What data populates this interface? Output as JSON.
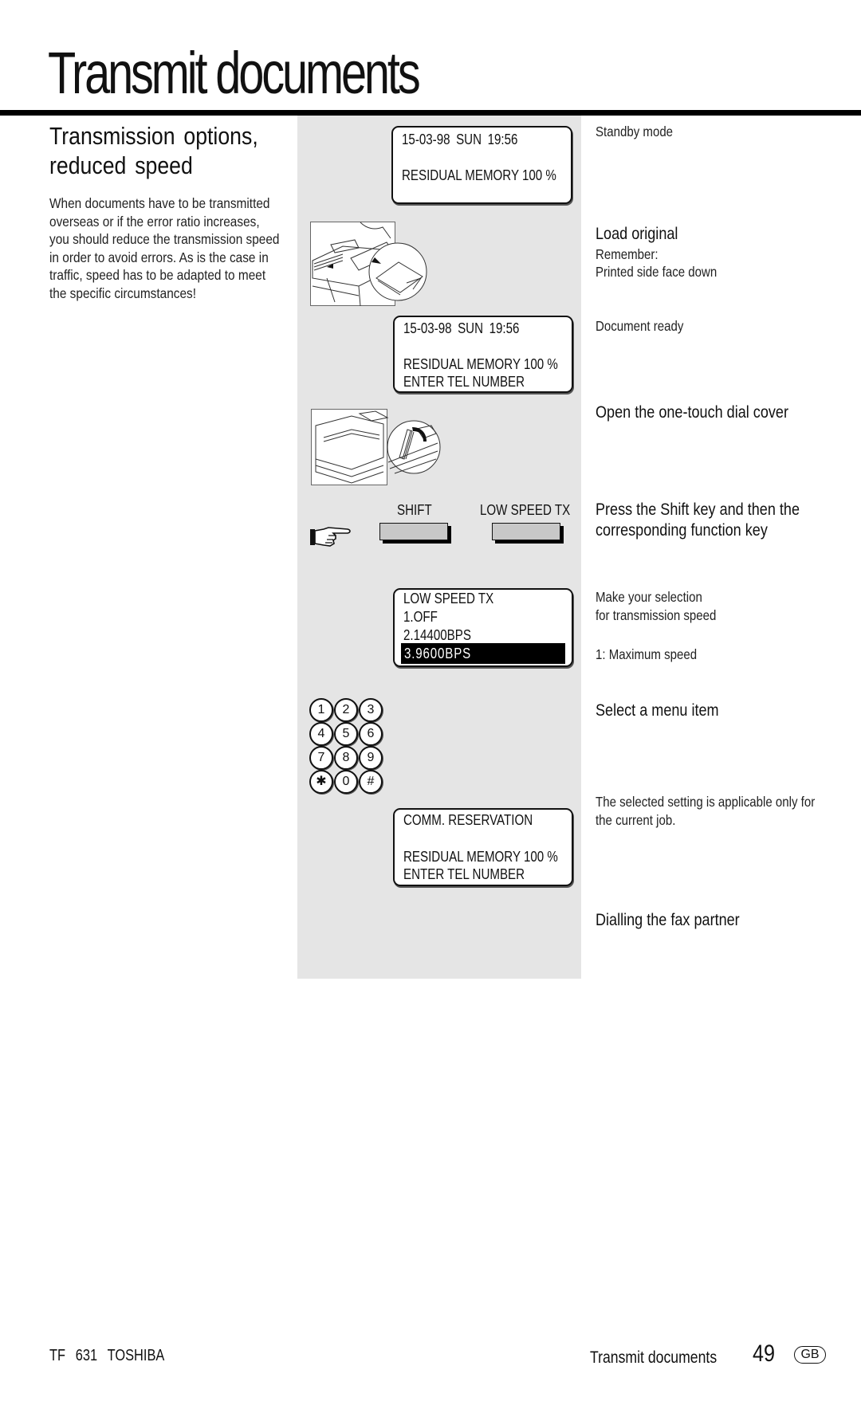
{
  "page": {
    "title": "Transmit documents"
  },
  "section": {
    "title_line1": "Transmission options,",
    "title_line2": "reduced speed",
    "intro_lines": [
      "When documents have to be transmitted",
      "overseas or if the error ratio increases,",
      "you should reduce the transmission speed",
      "in order to avoid errors. As is the case in",
      "traffic, speed has to be adapted to meet",
      "the specific circumstances!"
    ]
  },
  "steps": {
    "lcd1": {
      "line1": "15-03-98    SUN    19:56",
      "line2": "RESIDUAL MEMORY 100 %"
    },
    "lcd2": {
      "line1": "15-03-98    SUN    19:56",
      "line2": "RESIDUAL MEMORY 100 %",
      "line3": "ENTER TEL NUMBER"
    },
    "keys": {
      "shift_label": "SHIFT",
      "function_label": "LOW SPEED TX"
    },
    "lcd3": {
      "line1": "LOW SPEED TX",
      "line2": "1.OFF",
      "line3": "2.14400BPS",
      "selected": "3.9600BPS"
    },
    "keypad": [
      "1",
      "2",
      "3",
      "4",
      "5",
      "6",
      "7",
      "8",
      "9",
      "✱",
      "0",
      "#"
    ],
    "lcd4": {
      "line1": "COMM. RESERVATION",
      "line2": "RESIDUAL MEMORY 100 %",
      "line3": "ENTER TEL NUMBER"
    },
    "illustrations": {
      "load_original": "fax-load-original-illustration",
      "open_cover": "fax-open-cover-illustration",
      "pointing_hand": "pointing-hand-icon"
    }
  },
  "instructions": {
    "standby": "Standby mode",
    "load_original": "Load original",
    "remember": "Remember:",
    "printed_side": "Printed side face down",
    "document_ready": "Document ready",
    "open_cover": "Open the one-touch dial cover",
    "press_shift_1": "Press the Shift key and then the",
    "press_shift_2": "corresponding function key",
    "make_selection_1": "Make your selection",
    "make_selection_2": "for transmission speed",
    "max_speed": "1: Maximum speed",
    "select_menu": "Select a menu item",
    "applicable_1": "The selected setting is applicable only for",
    "applicable_2": "the current job.",
    "dialling": "Dialling the fax partner"
  },
  "footer": {
    "model": "TF 631",
    "brand": "TOSHIBA",
    "chapter": "Transmit documents",
    "page_number": "49",
    "language_badge": "GB"
  }
}
